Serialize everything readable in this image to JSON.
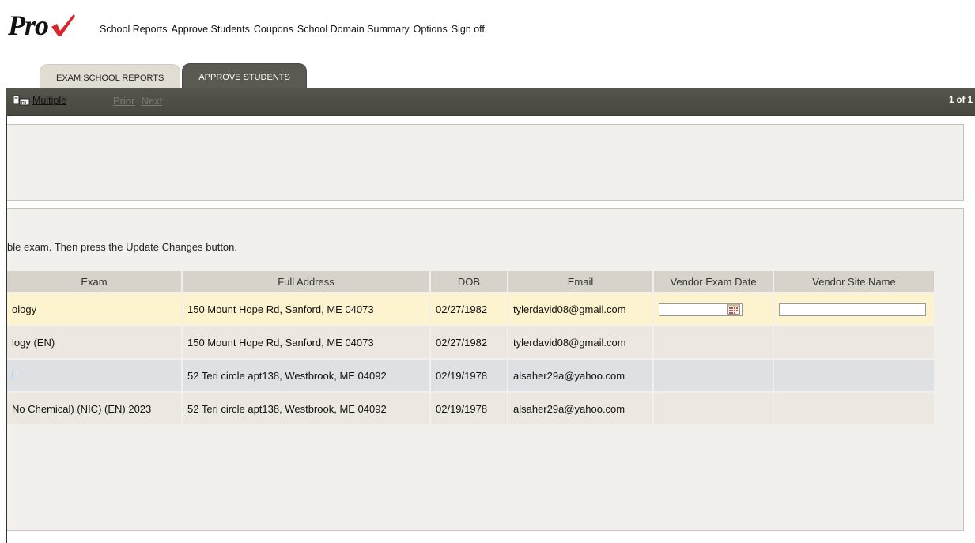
{
  "app": {
    "logo_text": "Pro",
    "check_color": "#d7262d"
  },
  "nav": {
    "items": [
      "School Reports",
      "Approve Students",
      "Coupons",
      "School Domain Summary",
      "Options",
      "Sign off"
    ]
  },
  "tabs": [
    {
      "label": "EXAM SCHOOL REPORTS",
      "active": false
    },
    {
      "label": "APPROVE STUDENTS",
      "active": true
    }
  ],
  "toolbar": {
    "multiple_label": "Multiple",
    "multiple_icon": "multiple-select-icon",
    "prior_label": "Prior",
    "next_label": "Next",
    "page_indicator": "1 of 1"
  },
  "instruction": "ble exam. Then press the Update Changes button.",
  "table": {
    "columns": [
      "Exam",
      "Full Address",
      "DOB",
      "Email",
      "Vendor Exam Date",
      "Vendor Site Name"
    ],
    "rows": [
      {
        "exam": "ology",
        "address": "150 Mount Hope Rd, Sanford, ME 04073",
        "dob": "02/27/1982",
        "email": "tylerdavid08@gmail.com",
        "vendor_exam_date": "",
        "vendor_site_name": ""
      },
      {
        "exam": "logy (EN)",
        "address": "150 Mount Hope Rd, Sanford, ME 04073",
        "dob": "02/27/1982",
        "email": "tylerdavid08@gmail.com"
      },
      {
        "exam": "l",
        "address": "52 Teri circle apt138, Westbrook, ME 04092",
        "dob": "02/19/1978",
        "email": "alsaher29a@yahoo.com"
      },
      {
        "exam": "No Chemical) (NIC) (EN) 2023",
        "address": "52 Teri circle apt138, Westbrook, ME 04092",
        "dob": "02/19/1978",
        "email": "alsaher29a@yahoo.com"
      }
    ]
  }
}
